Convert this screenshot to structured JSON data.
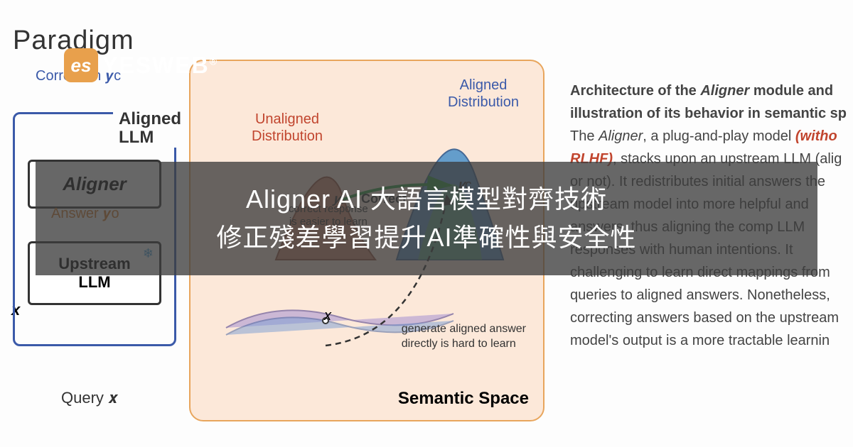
{
  "header": {
    "paradigm": "Paradigm",
    "logo_badge": "es",
    "logo_text": "YESWEB",
    "logo_r": "®"
  },
  "left": {
    "correction": "Correction 𝒚c",
    "aligned_llm": "Aligned\nLLM",
    "aligner": "Aligner",
    "answer": "Answer 𝒚o",
    "upstream": "Upstream",
    "upstream_sub": "LLM",
    "x": "x",
    "query": "Query 𝒙"
  },
  "semantic": {
    "unaligned": "Unaligned\nDistribution",
    "aligned": "Aligned\nDistribution",
    "correct": "Correct",
    "easier": "correct response\nis easier to learn",
    "yo": "𝒚o",
    "yc": "𝒚c",
    "x": "x",
    "hard": "generate aligned answer\ndirectly is hard to learn",
    "label": "Semantic Space"
  },
  "desc": {
    "line1a": "Architecture of the ",
    "line1b": "Aligner",
    "line1c": " module and illustration of its behavior in semantic sp",
    "line2a": "The ",
    "line2b": "Aligner",
    "line2c": ", a plug-and-play model ",
    "line2d": "(witho RLHF)",
    "line2e": ", stacks upon an upstream LLM (alig or not). It redistributes initial answers the upstream model into more helpful and answers, thus aligning the comp LLM responses with human intentions. It challenging to learn direct mappings from queries to aligned answers. Nonetheless, correcting answers based on the upstream model's output is a more tractable learnin"
  },
  "overlay": {
    "line1": "Aligner AI 大語言模型對齊技術",
    "line2": "修正殘差學習提升AI準確性與安全性"
  }
}
